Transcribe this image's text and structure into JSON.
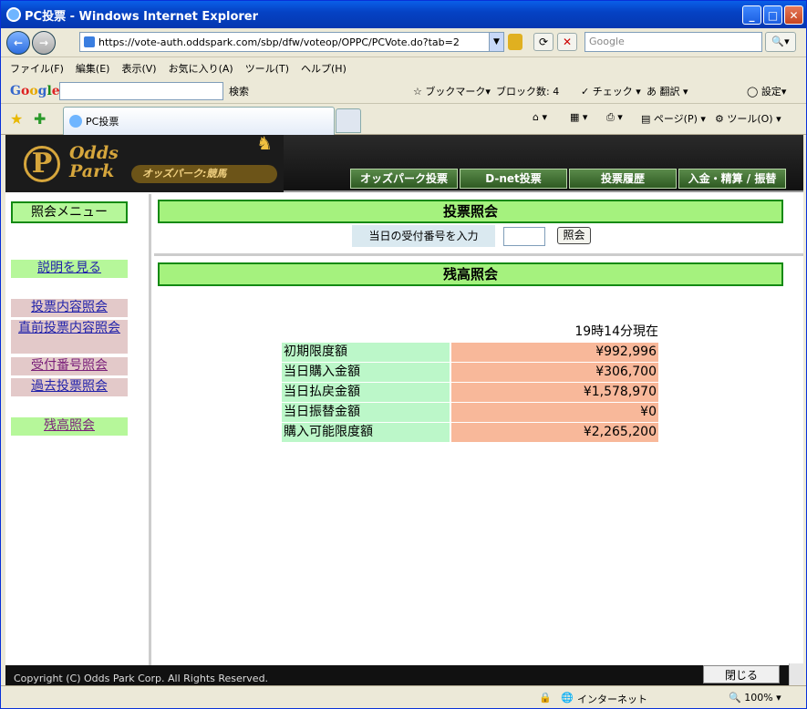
{
  "window": {
    "title": "PC投票 - Windows Internet Explorer"
  },
  "address": {
    "url": "https://vote-auth.oddspark.com/sbp/dfw/voteop/OPPC/PCVote.do?tab=2",
    "search_placeholder": "Google"
  },
  "menu": [
    "ファイル(F)",
    "編集(E)",
    "表示(V)",
    "お気に入り(A)",
    "ツール(T)",
    "ヘルプ(H)"
  ],
  "google_toolbar": {
    "logo": "Google",
    "search_label": "検索",
    "bookmarks": "ブックマーク",
    "blocked": "ブロック数: 4",
    "check": "チェック",
    "translate": "翻訳",
    "settings": "設定"
  },
  "tab": {
    "title": "PC投票"
  },
  "command_bar": {
    "page": "ページ(P)",
    "tools": "ツール(O)"
  },
  "site": {
    "logo_text": "Odds Park",
    "logo_tag": "オッズパーク:競馬",
    "nav": [
      "オッズパーク投票",
      "D-net投票",
      "投票履歴",
      "入金・精算 / 振替"
    ]
  },
  "left_menu": {
    "title": "照会メニュー",
    "items": [
      "説明を見る",
      "投票内容照会",
      "直前投票内容照会",
      "受付番号照会",
      "過去投票照会",
      "残高照会"
    ]
  },
  "vote_inquiry": {
    "heading": "投票照会",
    "input_label": "当日の受付番号を入力",
    "button": "照会"
  },
  "balance": {
    "heading": "残高照会",
    "timestamp": "19時14分現在",
    "rows": [
      {
        "label": "初期限度額",
        "value": "¥992,996"
      },
      {
        "label": "当日購入金額",
        "value": "¥306,700"
      },
      {
        "label": "当日払戻金額",
        "value": "¥1,578,970"
      },
      {
        "label": "当日振替金額",
        "value": "¥0"
      },
      {
        "label": "購入可能限度額",
        "value": "¥2,265,200"
      }
    ]
  },
  "footer": {
    "copyright": "Copyright (C) Odds Park Corp. All Rights Reserved.",
    "close": "閉じる"
  },
  "status": {
    "zone": "インターネット",
    "zoom": "100%"
  }
}
